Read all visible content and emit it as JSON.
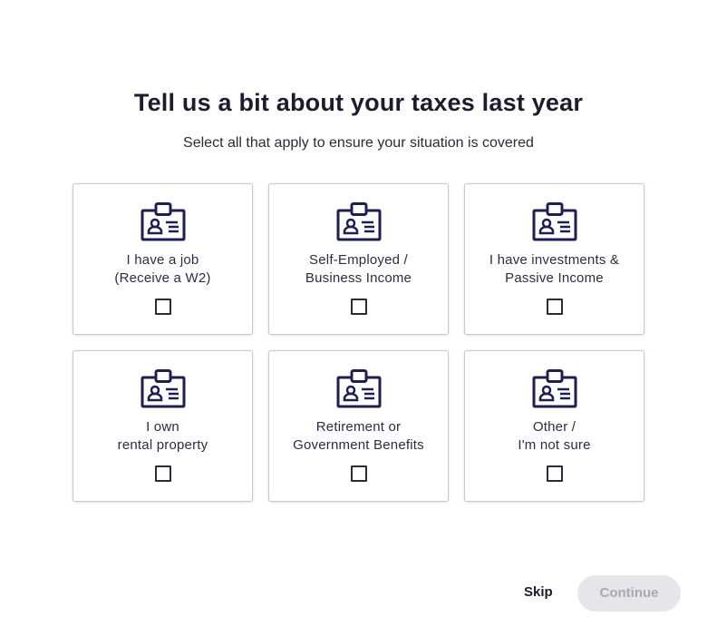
{
  "header": {
    "title": "Tell us a bit about your taxes last year",
    "subtitle": "Select all that apply to ensure your situation is covered"
  },
  "options": [
    {
      "line1": "I have a job",
      "line2": "(Receive a W2)",
      "icon": "id-badge-icon",
      "checked": false
    },
    {
      "line1": "Self-Employed /",
      "line2": "Business Income",
      "icon": "id-badge-icon",
      "checked": false
    },
    {
      "line1": "I have investments &",
      "line2": "Passive Income",
      "icon": "id-badge-icon",
      "checked": false
    },
    {
      "line1": "I own",
      "line2": "rental property",
      "icon": "id-badge-icon",
      "checked": false
    },
    {
      "line1": "Retirement or",
      "line2": "Government Benefits",
      "icon": "id-badge-icon",
      "checked": false
    },
    {
      "line1": "Other /",
      "line2": "I'm not sure",
      "icon": "id-badge-icon",
      "checked": false
    }
  ],
  "footer": {
    "skip_label": "Skip",
    "continue_label": "Continue",
    "continue_enabled": false
  },
  "colors": {
    "icon_navy": "#1e1e50",
    "continue_disabled_bg": "#e6e6ea",
    "continue_disabled_text": "#a8a8b2"
  }
}
